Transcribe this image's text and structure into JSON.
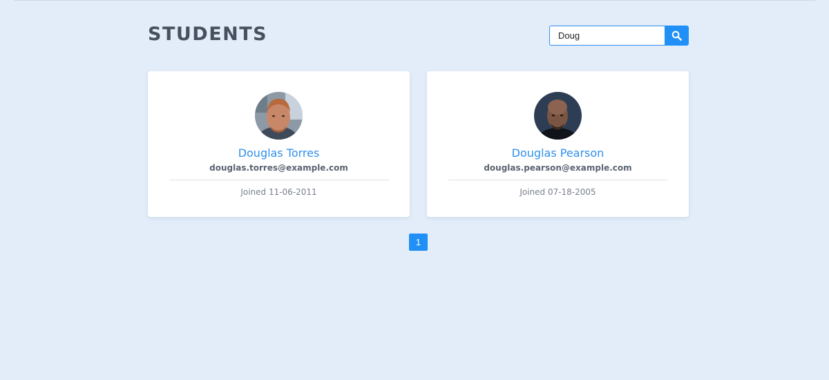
{
  "page": {
    "title": "STUDENTS"
  },
  "search": {
    "value": "Doug",
    "icon": "search-icon"
  },
  "students": [
    {
      "name": "Douglas Torres",
      "email": "douglas.torres@example.com",
      "joined": "Joined 11-06-2011"
    },
    {
      "name": "Douglas Pearson",
      "email": "douglas.pearson@example.com",
      "joined": "Joined 07-18-2005"
    }
  ],
  "pagination": {
    "pages": [
      "1"
    ],
    "current": "1"
  },
  "colors": {
    "background": "#e3edf9",
    "accent": "#2190f6",
    "title": "#46505f",
    "name": "#2e8fec"
  }
}
